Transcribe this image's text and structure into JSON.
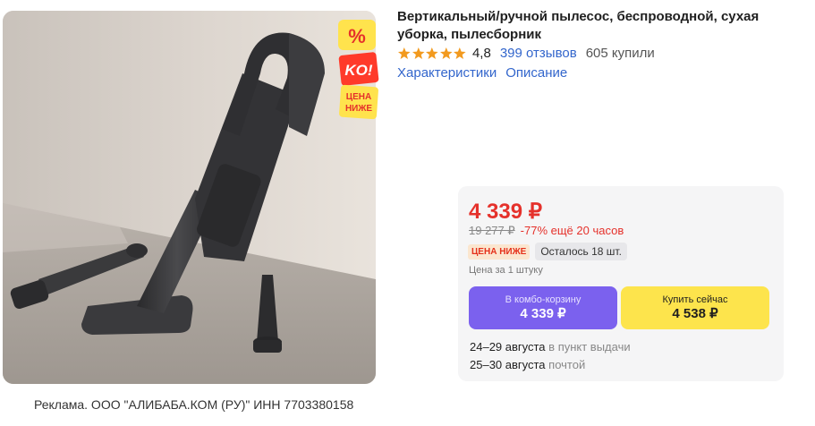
{
  "product": {
    "title": "Вертикальный/ручной пылесос, беспроводной, сухая уборка, пылесборник",
    "rating": "4,8",
    "reviews": "399 отзывов",
    "buyers": "605 купили",
    "tabs": [
      "Характеристики",
      "Описание"
    ]
  },
  "promo_badge": {
    "percent": "%",
    "ko": "KO!",
    "line1": "ЦЕНА",
    "line2": "НИЖЕ"
  },
  "ad_disclaimer": "Реклама. ООО \"АЛИБАБА.КОМ (РУ)\" ИНН  7703380158",
  "buy_box": {
    "price": "4 339 ₽",
    "old_price": "19 277 ₽",
    "discount_note": "-77% ещё 20 часов",
    "chip_price_lower": "ЦЕНА НИЖЕ",
    "chip_stock": "Осталось 18 шт.",
    "unit_price": "Цена за 1 штуку",
    "combo_button": {
      "label": "В комбо-корзину",
      "price": "4 339 ₽"
    },
    "buy_button": {
      "label": "Купить сейчас",
      "price": "4 538 ₽"
    },
    "delivery": [
      {
        "dates": "24–29 августа",
        "method": "в пункт выдачи"
      },
      {
        "dates": "25–30 августа",
        "method": "почтой"
      }
    ]
  },
  "colors": {
    "price_red": "#e5312b",
    "link_blue": "#3366cc",
    "combo_purple": "#7b61ee",
    "buy_yellow": "#fde44c",
    "star_orange": "#f29a1f"
  },
  "rating_stars": 5
}
